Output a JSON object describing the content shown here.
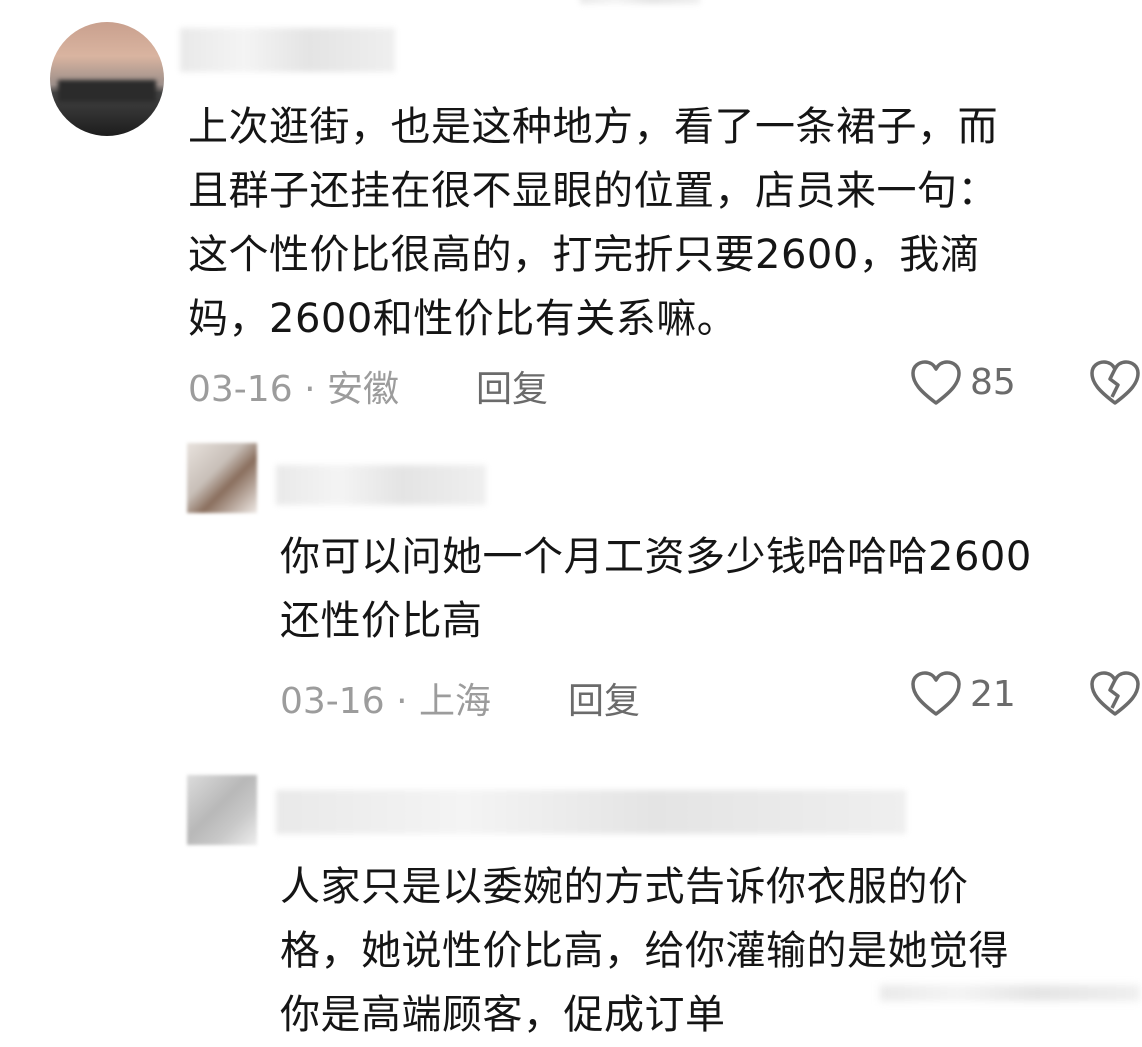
{
  "comments": [
    {
      "text": "上次逛街，也是这种地方，看了一条裙子，而\n且群子还挂在很不显眼的位置，店员来一句：\n这个性价比很高的，打完折只要2600，我滴\n妈，2600和性价比有关系嘛。",
      "date": "03-16",
      "location": "安徽",
      "reply_label": "回复",
      "likes": "85"
    },
    {
      "text": "你可以问她一个月工资多少钱哈哈哈2600\n还性价比高",
      "date": "03-16",
      "location": "上海",
      "reply_label": "回复",
      "likes": "21"
    },
    {
      "text": "人家只是以委婉的方式告诉你衣服的价\n格，她说性价比高，给你灌输的是她觉得\n你是高端顾客，促成订单"
    }
  ],
  "icons": {
    "like": "heart-outline-icon",
    "dislike": "broken-heart-icon"
  },
  "colors": {
    "text": "#151515",
    "meta": "#9c9c9c",
    "action": "#6b6b6b"
  }
}
